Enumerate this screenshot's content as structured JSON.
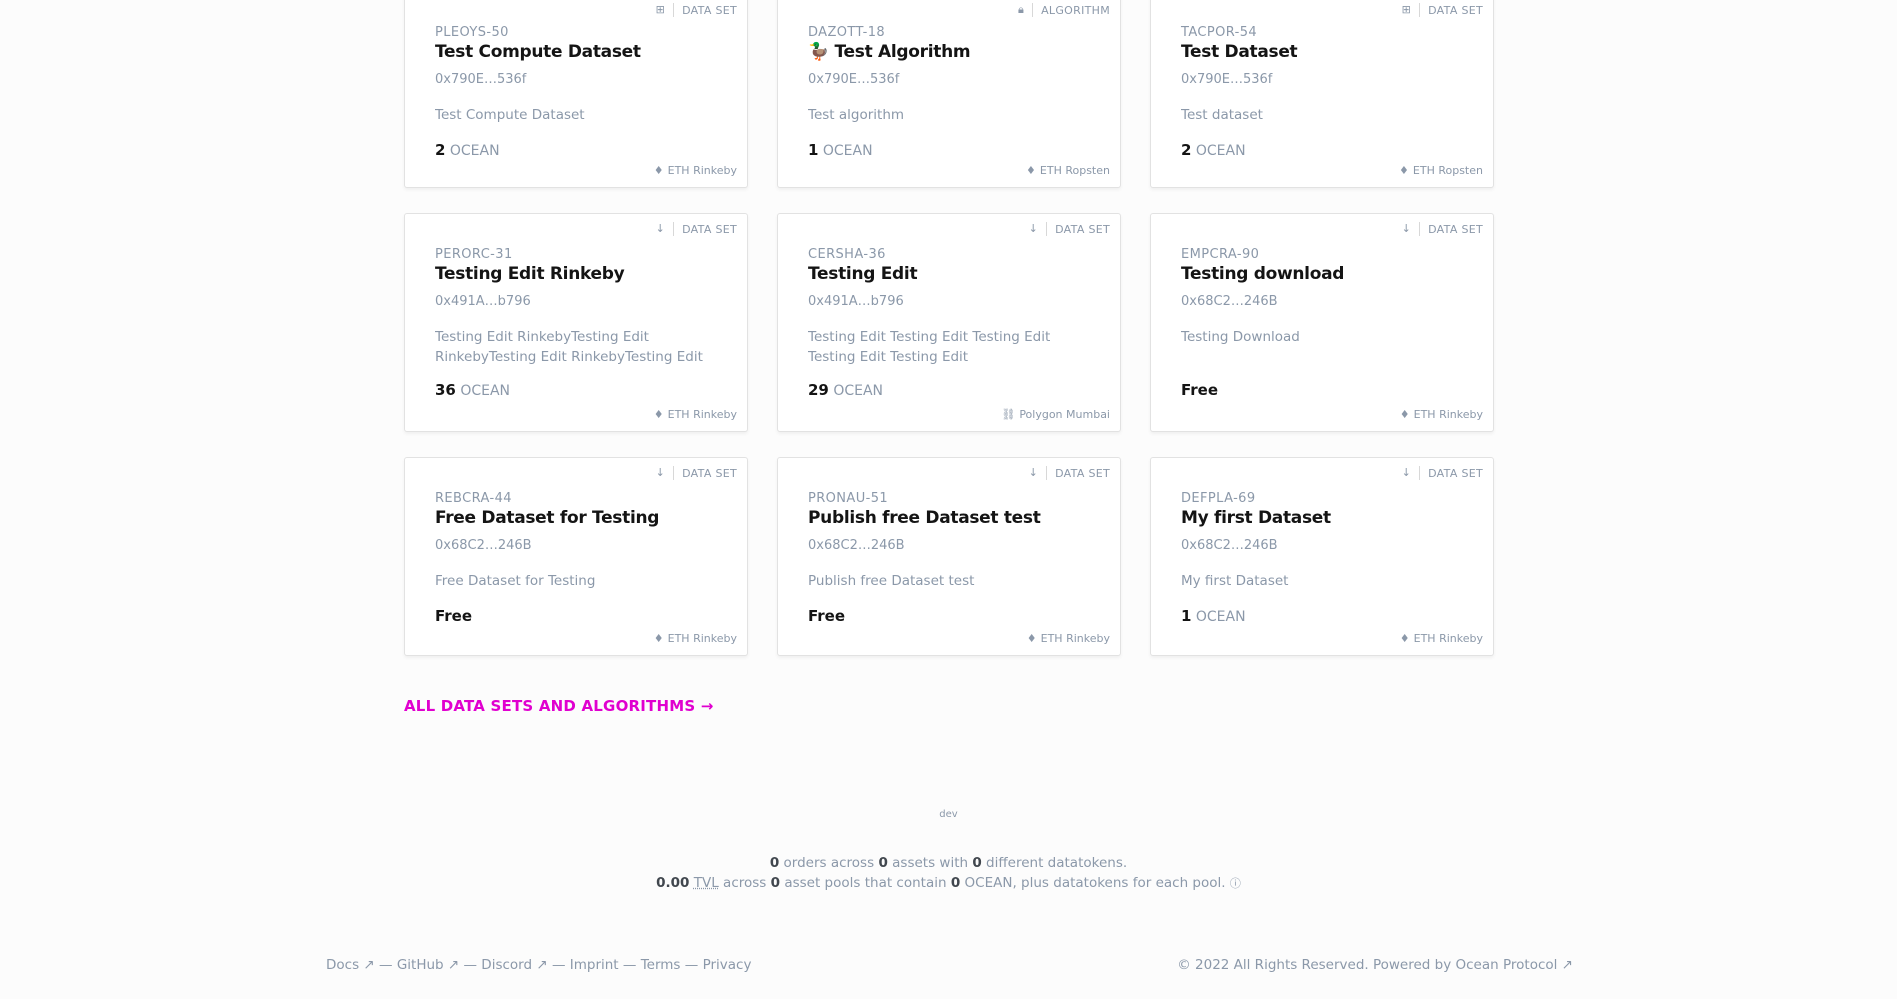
{
  "rows": [
    [
      {
        "type": "DATA SET",
        "type_icon": "compute-icon",
        "symbol": "PLEOYS-50",
        "title": "Test Compute Dataset",
        "owner": "0x790E…536f",
        "description": "Test Compute Dataset",
        "price_value": "2",
        "price_unit": "OCEAN",
        "free": "",
        "network": "ETH Rinkeby",
        "network_icon": "ethereum-icon"
      },
      {
        "type": "ALGORITHM",
        "type_icon": "lock-icon",
        "symbol": "DAZOTT-18",
        "title": "🦆 Test Algorithm",
        "owner": "0x790E…536f",
        "description": "Test algorithm",
        "price_value": "1",
        "price_unit": "OCEAN",
        "free": "",
        "network": "ETH Ropsten",
        "network_icon": "ethereum-icon"
      },
      {
        "type": "DATA SET",
        "type_icon": "compute-icon",
        "symbol": "TACPOR-54",
        "title": "Test Dataset",
        "owner": "0x790E…536f",
        "description": "Test dataset",
        "price_value": "2",
        "price_unit": "OCEAN",
        "free": "",
        "network": "ETH Ropsten",
        "network_icon": "ethereum-icon"
      }
    ],
    [
      {
        "type": "DATA SET",
        "type_icon": "download-icon",
        "symbol": "PERORC-31",
        "title": "Testing Edit Rinkeby",
        "owner": "0x491A…b796",
        "description": "Testing Edit RinkebyTesting Edit RinkebyTesting Edit RinkebyTesting Edit …",
        "price_value": "36",
        "price_unit": "OCEAN",
        "free": "",
        "network": "ETH Rinkeby",
        "network_icon": "ethereum-icon"
      },
      {
        "type": "DATA SET",
        "type_icon": "download-icon",
        "symbol": "CERSHA-36",
        "title": "Testing Edit",
        "owner": "0x491A…b796",
        "description": "Testing Edit Testing Edit Testing Edit Testing Edit Testing Edit",
        "price_value": "29",
        "price_unit": "OCEAN",
        "free": "",
        "network": "Polygon Mumbai",
        "network_icon": "polygon-icon"
      },
      {
        "type": "DATA SET",
        "type_icon": "download-icon",
        "symbol": "EMPCRA-90",
        "title": "Testing download",
        "owner": "0x68C2…246B",
        "description": "Testing Download",
        "price_value": "",
        "price_unit": "",
        "free": "Free",
        "network": "ETH Rinkeby",
        "network_icon": "ethereum-icon"
      }
    ],
    [
      {
        "type": "DATA SET",
        "type_icon": "download-icon",
        "symbol": "REBCRA-44",
        "title": "Free Dataset for Testing",
        "owner": "0x68C2…246B",
        "description": "Free Dataset for Testing",
        "price_value": "",
        "price_unit": "",
        "free": "Free",
        "network": "ETH Rinkeby",
        "network_icon": "ethereum-icon"
      },
      {
        "type": "DATA SET",
        "type_icon": "download-icon",
        "symbol": "PRONAU-51",
        "title": "Publish free Dataset test",
        "owner": "0x68C2…246B",
        "description": "Publish free Dataset test",
        "price_value": "",
        "price_unit": "",
        "free": "Free",
        "network": "ETH Rinkeby",
        "network_icon": "ethereum-icon"
      },
      {
        "type": "DATA SET",
        "type_icon": "download-icon",
        "symbol": "DEFPLA-69",
        "title": "My first Dataset",
        "owner": "0x68C2…246B",
        "description": "My first Dataset",
        "price_value": "1",
        "price_unit": "OCEAN",
        "free": "",
        "network": "ETH Rinkeby",
        "network_icon": "ethereum-icon"
      }
    ]
  ],
  "all_link": "ALL DATA SETS AND ALGORITHMS →",
  "env": "dev",
  "stats": {
    "orders": "0",
    "orders_text": "orders across",
    "assets": "0",
    "assets_text": "assets with",
    "datatokens": "0",
    "datatokens_text": "different datatokens.",
    "tvl_value": "0.00",
    "tvl_label": "TVL",
    "across_text": "across",
    "pools": "0",
    "pools_text": "asset pools that contain",
    "ocean": "0",
    "ocean_text": "OCEAN, plus datatokens for each pool.",
    "info_icon": "ⓘ"
  },
  "footer": {
    "links": [
      "Docs ↗",
      "GitHub ↗",
      "Discord ↗",
      "Imprint",
      "Terms",
      "Privacy"
    ],
    "separator": " — ",
    "copyright": "© 2022 All Rights Reserved. Powered by Ocean Protocol ↗"
  },
  "colors": {
    "accent": "#e000cf",
    "text": "#141414",
    "muted": "#8b98a9"
  }
}
